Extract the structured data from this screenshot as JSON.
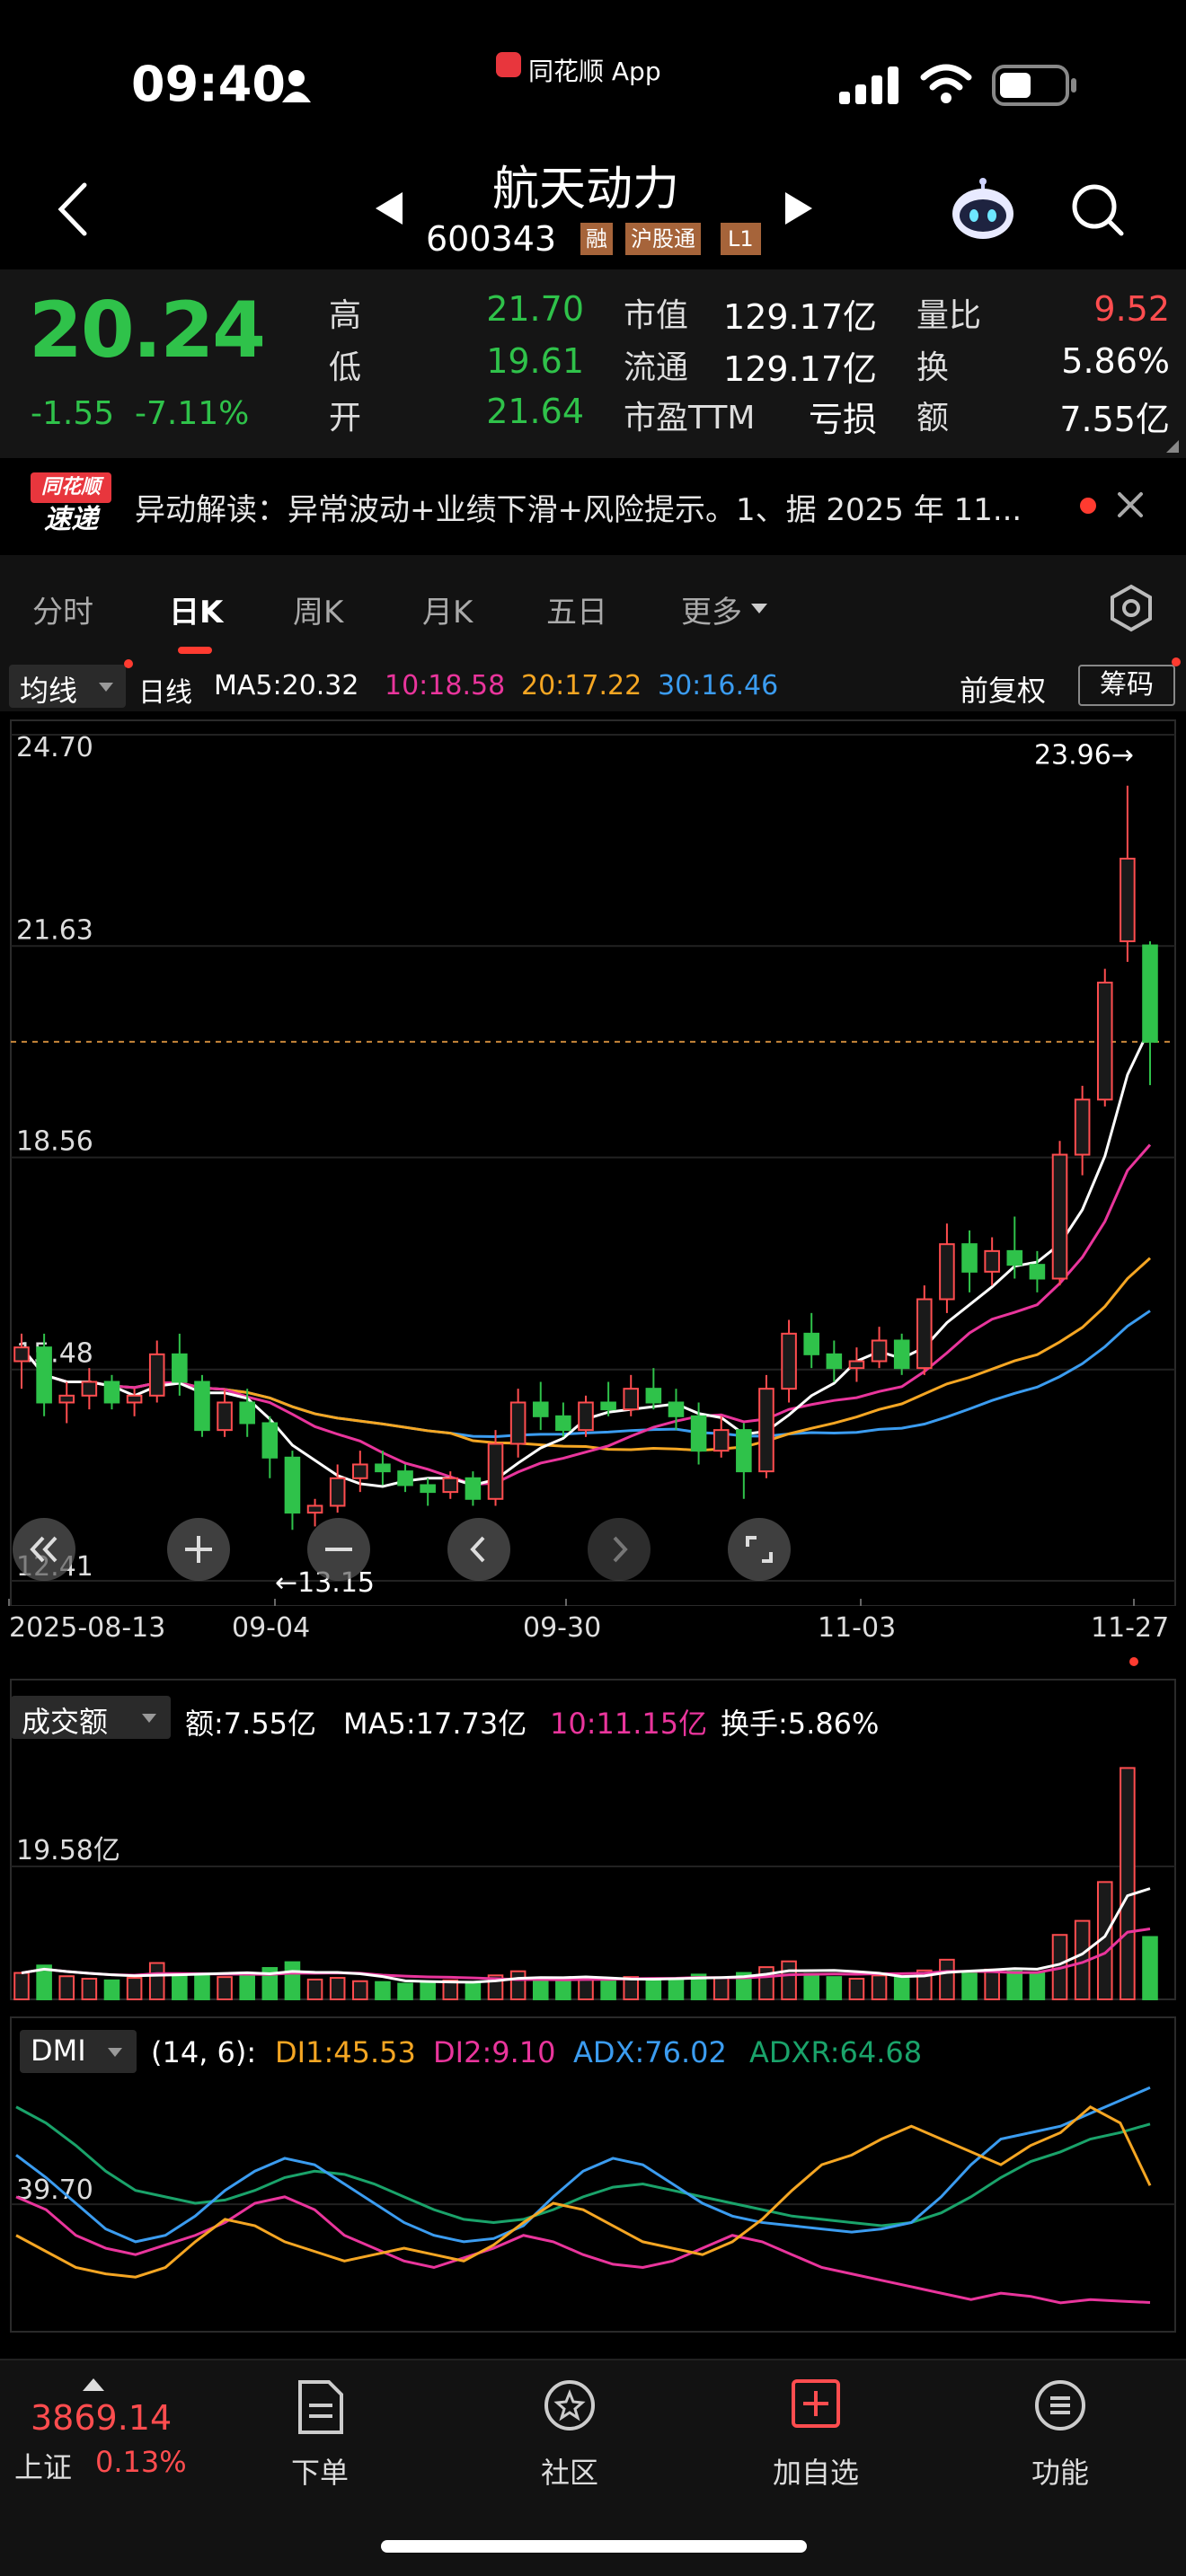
{
  "status_bar": {
    "time": "09:40",
    "app_tag": "同花顺 App"
  },
  "header": {
    "name": "航天动力",
    "code": "600343",
    "badges": [
      "融",
      "沪股通",
      "L1"
    ]
  },
  "quote": {
    "price": "20.24",
    "change": "-1.55",
    "change_pct": "-7.11%",
    "stats": [
      {
        "label": "高",
        "value": "21.70",
        "color": "green"
      },
      {
        "label": "市值",
        "value": "129.17亿",
        "color": "white"
      },
      {
        "label": "量比",
        "value": "9.52",
        "color": "red"
      },
      {
        "label": "低",
        "value": "19.61",
        "color": "green"
      },
      {
        "label": "流通",
        "value": "129.17亿",
        "color": "white"
      },
      {
        "label": "换",
        "value": "5.86%",
        "color": "white"
      },
      {
        "label": "开",
        "value": "21.64",
        "color": "green"
      },
      {
        "label": "市盈TTM",
        "value": "亏损",
        "color": "white"
      },
      {
        "label": "额",
        "value": "7.55亿",
        "color": "white"
      }
    ]
  },
  "news": {
    "logo_top": "同花顺",
    "logo_bottom": "速递",
    "text": "异动解读：异常波动+业绩下滑+风险提示。1、据 2025 年 11..."
  },
  "tabs": [
    "分时",
    "日K",
    "周K",
    "月K",
    "五日",
    "更多"
  ],
  "active_tab": "日K",
  "kline_bar": {
    "selector": "均线",
    "period": "日线",
    "ma5": "MA5:20.32",
    "ma10": "10:18.58",
    "ma20": "20:17.22",
    "ma30": "30:16.46",
    "adjust": "前复权",
    "chips": "筹码"
  },
  "price_axis": [
    "24.70",
    "21.63",
    "18.56",
    "15.48",
    "12.41"
  ],
  "max_marker": "23.96→",
  "min_marker": "←13.15",
  "date_axis": [
    "2025-08-13",
    "09-04",
    "09-30",
    "11-03",
    "11-27"
  ],
  "volume_bar": {
    "selector": "成交额",
    "amount": "额:7.55亿",
    "ma5": "MA5:17.73亿",
    "ma10": "10:11.15亿",
    "turnover": "换手:5.86%",
    "axis_label": "19.58亿"
  },
  "dmi_bar": {
    "selector": "DMI",
    "params": "(14, 6):",
    "di1": "DI1:45.53",
    "di2": "DI2:9.10",
    "adx": "ADX:76.02",
    "adxr": "ADXR:64.68",
    "axis_label": "39.70"
  },
  "bottom_nav": {
    "index_value": "3869.14",
    "index_name": "上证",
    "index_pct": "0.13%",
    "items": [
      {
        "label": "下单",
        "icon": "order-icon"
      },
      {
        "label": "社区",
        "icon": "community-icon"
      },
      {
        "label": "加自选",
        "icon": "add-watchlist-icon"
      },
      {
        "label": "功能",
        "icon": "menu-icon"
      }
    ]
  },
  "colors": {
    "up": "#ff4d4f",
    "down": "#2fc24a",
    "ma5": "#ffffff",
    "ma10": "#e9359c",
    "ma20": "#f5a623",
    "ma30": "#3b9cf0",
    "adxr": "#1aa36a"
  },
  "chart_data": {
    "type": "candlestick",
    "price_range": [
      12.41,
      24.7
    ],
    "last_close": 20.24,
    "high": 23.96,
    "low": 13.15,
    "candles": [
      [
        15.6,
        16.0,
        15.2,
        15.8
      ],
      [
        15.8,
        16.0,
        14.8,
        15.0
      ],
      [
        15.0,
        15.3,
        14.7,
        15.1
      ],
      [
        15.1,
        15.5,
        14.9,
        15.3
      ],
      [
        15.3,
        15.4,
        14.9,
        15.0
      ],
      [
        15.0,
        15.2,
        14.8,
        15.1
      ],
      [
        15.1,
        15.9,
        15.0,
        15.7
      ],
      [
        15.7,
        16.0,
        15.1,
        15.3
      ],
      [
        15.3,
        15.4,
        14.5,
        14.6
      ],
      [
        14.6,
        15.2,
        14.5,
        15.0
      ],
      [
        15.0,
        15.2,
        14.5,
        14.7
      ],
      [
        14.7,
        14.8,
        13.9,
        14.2
      ],
      [
        14.2,
        14.3,
        13.15,
        13.4
      ],
      [
        13.4,
        13.6,
        13.2,
        13.5
      ],
      [
        13.5,
        14.1,
        13.4,
        13.9
      ],
      [
        13.9,
        14.3,
        13.7,
        14.1
      ],
      [
        14.1,
        14.3,
        13.8,
        14.0
      ],
      [
        14.0,
        14.1,
        13.7,
        13.8
      ],
      [
        13.8,
        13.9,
        13.5,
        13.7
      ],
      [
        13.7,
        14.0,
        13.6,
        13.9
      ],
      [
        13.9,
        14.0,
        13.5,
        13.6
      ],
      [
        13.6,
        14.6,
        13.5,
        14.4
      ],
      [
        14.4,
        15.2,
        14.2,
        15.0
      ],
      [
        15.0,
        15.3,
        14.6,
        14.8
      ],
      [
        14.8,
        15.0,
        14.5,
        14.6
      ],
      [
        14.6,
        15.1,
        14.5,
        15.0
      ],
      [
        15.0,
        15.3,
        14.8,
        14.9
      ],
      [
        14.9,
        15.4,
        14.8,
        15.2
      ],
      [
        15.2,
        15.5,
        14.9,
        15.0
      ],
      [
        15.0,
        15.2,
        14.6,
        14.8
      ],
      [
        14.8,
        15.0,
        14.1,
        14.3
      ],
      [
        14.3,
        14.8,
        14.2,
        14.6
      ],
      [
        14.6,
        14.7,
        13.6,
        14.0
      ],
      [
        14.0,
        15.4,
        13.9,
        15.2
      ],
      [
        15.2,
        16.2,
        15.0,
        16.0
      ],
      [
        16.0,
        16.3,
        15.5,
        15.7
      ],
      [
        15.7,
        15.9,
        15.3,
        15.5
      ],
      [
        15.5,
        15.8,
        15.3,
        15.6
      ],
      [
        15.6,
        16.1,
        15.5,
        15.9
      ],
      [
        15.9,
        16.0,
        15.4,
        15.5
      ],
      [
        15.5,
        16.7,
        15.4,
        16.5
      ],
      [
        16.5,
        17.6,
        16.3,
        17.3
      ],
      [
        17.3,
        17.5,
        16.6,
        16.9
      ],
      [
        16.9,
        17.4,
        16.7,
        17.2
      ],
      [
        17.2,
        17.7,
        16.8,
        17.0
      ],
      [
        17.0,
        17.2,
        16.6,
        16.8
      ],
      [
        16.8,
        18.8,
        16.7,
        18.6
      ],
      [
        18.6,
        19.6,
        18.3,
        19.4
      ],
      [
        19.4,
        21.3,
        19.3,
        21.1
      ],
      [
        21.7,
        23.96,
        21.4,
        22.9
      ],
      [
        21.64,
        21.7,
        19.61,
        20.24
      ]
    ],
    "volume": [
      3.2,
      4.1,
      2.8,
      2.5,
      2.3,
      2.6,
      4.4,
      3.1,
      2.9,
      2.7,
      3.0,
      3.8,
      4.5,
      2.4,
      2.6,
      2.2,
      2.1,
      1.9,
      2.0,
      2.3,
      2.1,
      2.9,
      3.4,
      2.5,
      2.2,
      2.6,
      2.3,
      2.7,
      2.4,
      2.5,
      3.0,
      2.6,
      3.2,
      3.9,
      4.6,
      3.1,
      2.7,
      2.5,
      2.9,
      2.6,
      3.5,
      4.8,
      3.3,
      3.6,
      3.4,
      3.2,
      7.8,
      9.5,
      14.2,
      28.0,
      7.55
    ],
    "di1": [
      30,
      25,
      20,
      18,
      17,
      20,
      28,
      35,
      33,
      28,
      25,
      22,
      24,
      26,
      24,
      22,
      27,
      34,
      40,
      38,
      33,
      28,
      26,
      24,
      28,
      35,
      44,
      52,
      55,
      60,
      64,
      60,
      56,
      52,
      58,
      62,
      70,
      65,
      45.53
    ],
    "di2": [
      42,
      38,
      30,
      26,
      24,
      27,
      30,
      34,
      40,
      42,
      38,
      30,
      26,
      22,
      20,
      23,
      26,
      30,
      28,
      24,
      21,
      20,
      22,
      26,
      30,
      28,
      24,
      20,
      18,
      16,
      14,
      12,
      10,
      12,
      11,
      9,
      10,
      9.5,
      9.1
    ],
    "adx": [
      55,
      48,
      40,
      32,
      28,
      30,
      36,
      44,
      50,
      54,
      52,
      46,
      40,
      34,
      30,
      28,
      29,
      33,
      42,
      50,
      54,
      52,
      46,
      40,
      36,
      34,
      33,
      32,
      31,
      32,
      34,
      42,
      52,
      60,
      62,
      64,
      68,
      72,
      76.02
    ],
    "adxr": [
      70,
      65,
      58,
      50,
      44,
      42,
      40,
      41,
      44,
      48,
      50,
      49,
      46,
      42,
      38,
      35,
      34,
      35,
      38,
      42,
      45,
      46,
      44,
      42,
      40,
      38,
      36,
      35,
      34,
      33,
      34,
      37,
      42,
      48,
      53,
      56,
      60,
      62,
      64.68
    ]
  }
}
